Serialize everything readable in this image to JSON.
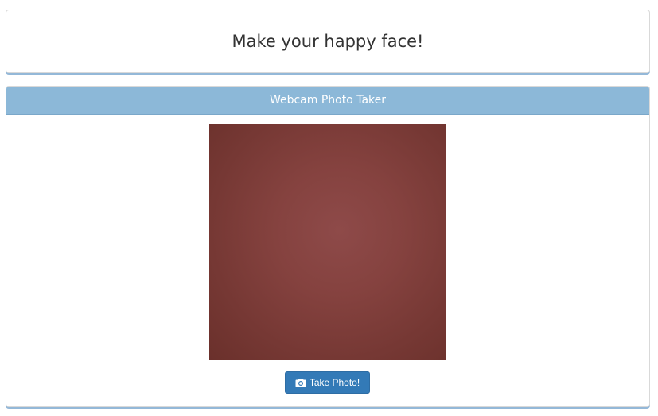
{
  "header": {
    "title": "Make your happy face!"
  },
  "webcam": {
    "heading": "Webcam Photo Taker",
    "take_photo_label": "Take Photo!",
    "take_photo_icon": "camera-icon"
  },
  "colors": {
    "heading_bg": "#8cb8d8",
    "button_bg": "#337ab7",
    "panel_shadow": "#94b8d8",
    "video_tint": "#85423f"
  }
}
